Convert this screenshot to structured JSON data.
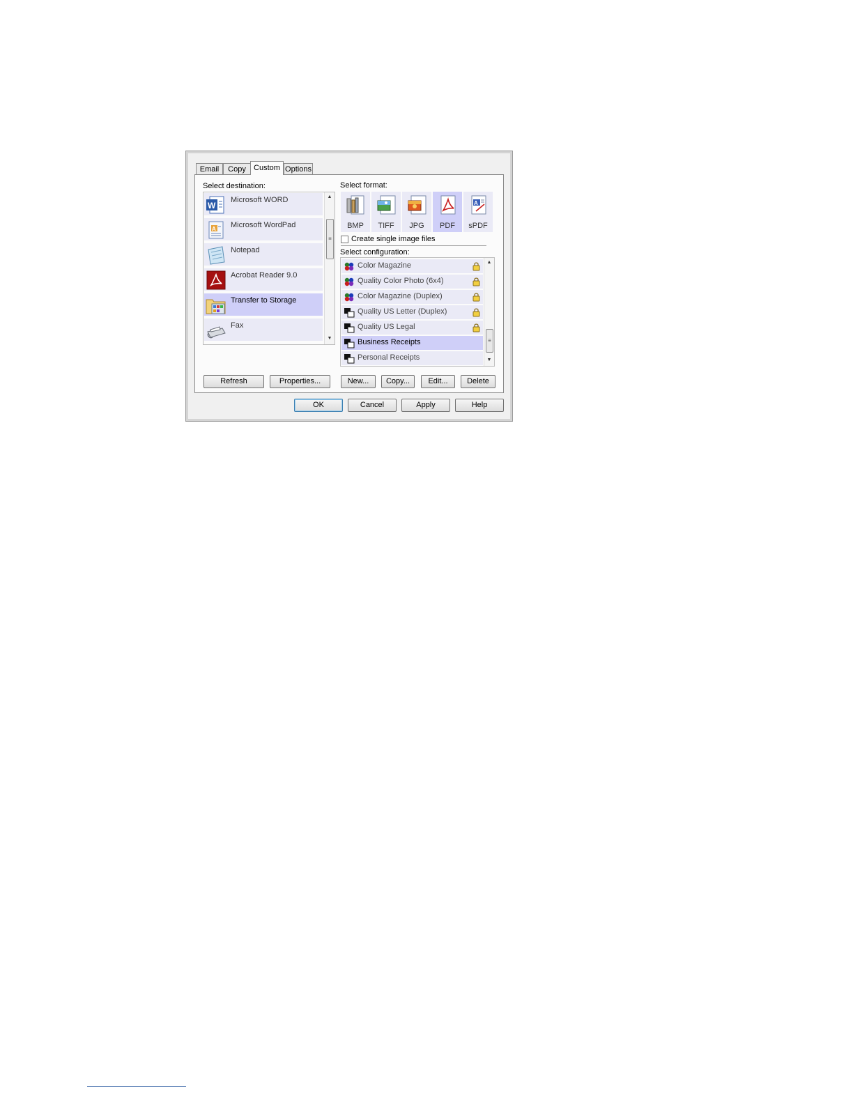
{
  "tabs": [
    "Email",
    "Copy",
    "Custom",
    "Options"
  ],
  "destination": {
    "label": "Select destination:",
    "items": [
      {
        "label": "Microsoft WORD",
        "icon": "word-icon"
      },
      {
        "label": "Microsoft WordPad",
        "icon": "wordpad-icon"
      },
      {
        "label": "Notepad",
        "icon": "notepad-icon"
      },
      {
        "label": "Acrobat Reader 9.0",
        "icon": "acrobat-icon"
      },
      {
        "label": "Transfer to Storage",
        "icon": "storage-folder-icon"
      },
      {
        "label": "Fax",
        "icon": "fax-icon"
      }
    ],
    "selected": "Transfer to Storage"
  },
  "format": {
    "label": "Select format:",
    "items": [
      "BMP",
      "TIFF",
      "JPG",
      "PDF",
      "sPDF"
    ],
    "selected": "PDF",
    "single_image_label": "Create single image files",
    "single_image_checked": false
  },
  "configuration": {
    "label": "Select configuration:",
    "items": [
      {
        "label": "Color Magazine",
        "type": "color",
        "locked": true
      },
      {
        "label": "Quality Color Photo (6x4)",
        "type": "color",
        "locked": true
      },
      {
        "label": "Color Magazine (Duplex)",
        "type": "color",
        "locked": true
      },
      {
        "label": "Quality US Letter (Duplex)",
        "type": "bw",
        "locked": true
      },
      {
        "label": "Quality US Legal",
        "type": "bw",
        "locked": true
      },
      {
        "label": "Business Receipts",
        "type": "bw",
        "locked": false
      },
      {
        "label": "Personal Receipts",
        "type": "bw",
        "locked": false
      }
    ],
    "selected": "Business Receipts"
  },
  "buttons": {
    "refresh": "Refresh",
    "properties": "Properties...",
    "new": "New...",
    "copy": "Copy...",
    "edit": "Edit...",
    "delete": "Delete",
    "ok": "OK",
    "cancel": "Cancel",
    "apply": "Apply",
    "help": "Help"
  },
  "colors": {
    "selected_bg": "#cfcff8",
    "item_bg": "#eaeaf6"
  }
}
